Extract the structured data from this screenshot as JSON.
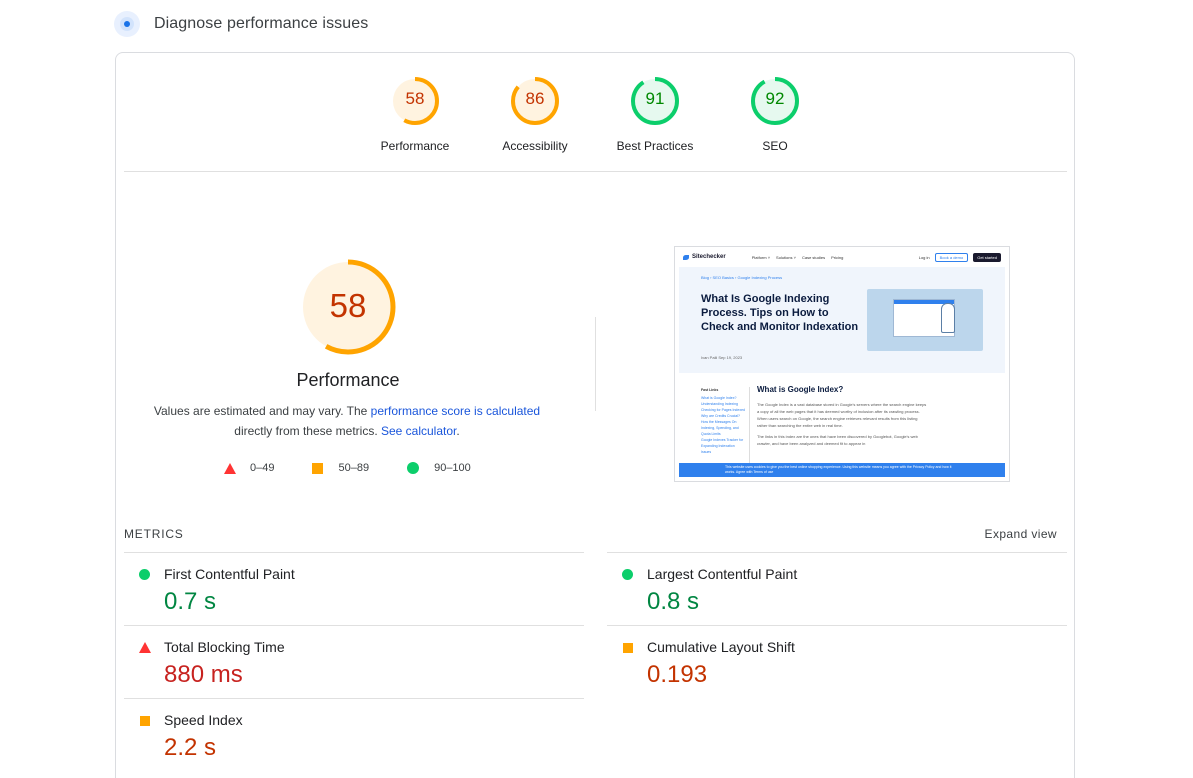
{
  "header": {
    "title": "Diagnose performance issues"
  },
  "scores": [
    {
      "label": "Performance",
      "value": 58,
      "color": "#ffa400",
      "text_color": "#c33300",
      "bg": "#fff3e0"
    },
    {
      "label": "Accessibility",
      "value": 86,
      "color": "#ffa400",
      "text_color": "#c33300",
      "bg": "#fff3e0"
    },
    {
      "label": "Best Practices",
      "value": 91,
      "color": "#0cce6b",
      "text_color": "#008800",
      "bg": "#e6f9ef"
    },
    {
      "label": "SEO",
      "value": 92,
      "color": "#0cce6b",
      "text_color": "#008800",
      "bg": "#e6f9ef"
    }
  ],
  "main_score": {
    "value": 58,
    "title": "Performance",
    "desc_part1": "Values are estimated and may vary. The ",
    "desc_link1": "performance score is calculated",
    "desc_part2": " directly from these metrics. ",
    "desc_link2": "See calculator",
    "desc_part3": "."
  },
  "legend": {
    "poor": "0–49",
    "average": "50–89",
    "good": "90–100"
  },
  "screenshot": {
    "logo": "Sitechecker",
    "nav_links": [
      "Platform ˅",
      "Solutions ˅",
      "Case studies",
      "Pricing"
    ],
    "login": "Log in",
    "book_demo": "Book a demo",
    "get_started": "Get started",
    "breadcrumb": "Blog  ›  SEO Basics  ›  Google Indexing Process",
    "headline": "What Is Google Indexing Process. Tips on How to Check and Monitor Indexation",
    "author": "Ivan Palii      Sep 19, 2023",
    "toc_title": "Fast Links",
    "toc_items": [
      "What is Google Index?",
      "Understanding Indexing",
      "Checking for Pages Indexed",
      "Why are Credits Crucial? How the Messages On Indexing, Spending, and Quota Limits",
      "Google Indexes Tracker for Expanding Indexation Issues"
    ],
    "h2": "What is Google Index?",
    "para1": "The Google Index is a vast database stored in Google's servers where the search engine keeps a copy of all the web pages that it has deemed worthy of inclusion after its crawling process. When users search on Google, the search engine retrieves relevant results from this listing rather than searching the entire web in real time.",
    "para2": "The links in this index are the ones that have been discovered by Googlebot, Google's web crawler, and have been analyzed and deemed fit to appear in",
    "banner": "This website uses cookies to give you the best online shopping experience. Using this website means you agree with the Privacy Policy and how it works. Agree with Terms of use"
  },
  "metrics": {
    "label": "METRICS",
    "expand": "Expand view",
    "items": [
      {
        "name": "First Contentful Paint",
        "value": "0.7 s",
        "status": "good"
      },
      {
        "name": "Largest Contentful Paint",
        "value": "0.8 s",
        "status": "good"
      },
      {
        "name": "Total Blocking Time",
        "value": "880 ms",
        "status": "poor"
      },
      {
        "name": "Cumulative Layout Shift",
        "value": "0.193",
        "status": "avg"
      },
      {
        "name": "Speed Index",
        "value": "2.2 s",
        "status": "avg"
      }
    ]
  }
}
